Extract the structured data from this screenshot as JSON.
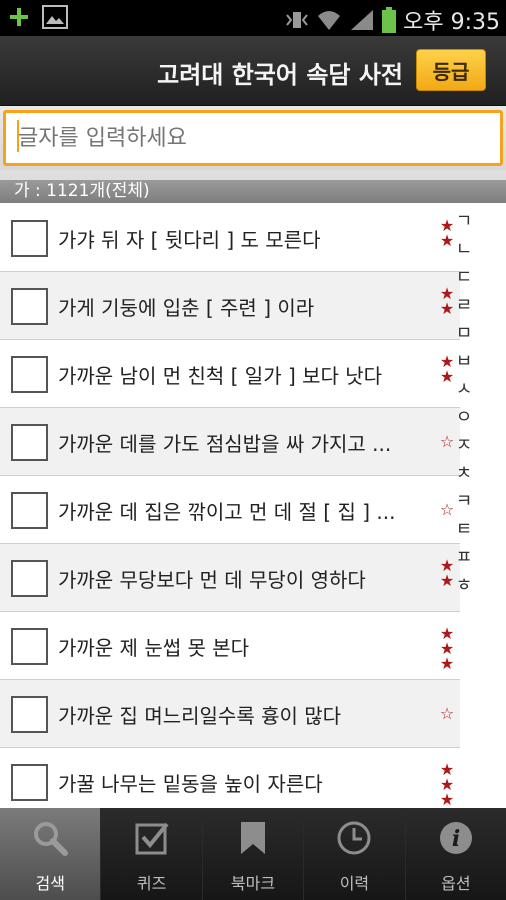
{
  "status_bar": {
    "time": "오후 9:35",
    "left_icons": [
      "add-icon",
      "image-icon"
    ],
    "right_icons": [
      "vibrate-icon",
      "wifi-icon",
      "signal-icon",
      "battery-icon"
    ]
  },
  "titlebar": {
    "title": "고려대 한국어 속담 사전",
    "grade_label": "등급"
  },
  "search": {
    "placeholder": "글자를 입력하세요",
    "value": ""
  },
  "section_header": "가 : 1121개(전체)",
  "list": {
    "items": [
      {
        "text": "가갸 뒤 자 [ 뒷다리 ] 도 모른다",
        "stars": 2
      },
      {
        "text": "가게 기둥에 입춘 [ 주련 ] 이라",
        "stars": 2
      },
      {
        "text": "가까운 남이 먼 친척 [ 일가 ] 보다 낫다",
        "stars": 2
      },
      {
        "text": "가까운 데를 가도 점심밥을 싸 가지고 ...",
        "stars": 0
      },
      {
        "text": "가까운 데 집은 깎이고 먼 데 절 [ 집 ] ...",
        "stars": 0
      },
      {
        "text": "가까운 무당보다 먼 데 무당이 영하다",
        "stars": 2
      },
      {
        "text": "가까운 제 눈썹 못 본다",
        "stars": 3
      },
      {
        "text": "가까운 집 며느리일수록 흉이 많다",
        "stars": 0
      },
      {
        "text": "가꿀 나무는 밑동을 높이 자른다",
        "stars": 3
      }
    ],
    "star_filled": "★",
    "star_empty": "☆"
  },
  "index_bar": [
    "ㄱ",
    "ㄴ",
    "ㄷ",
    "ㄹ",
    "ㅁ",
    "ㅂ",
    "ㅅ",
    "ㅇ",
    "ㅈ",
    "ㅊ",
    "ㅋ",
    "ㅌ",
    "ㅍ",
    "ㅎ"
  ],
  "nav": {
    "tabs": [
      {
        "label": "검색",
        "icon": "search-icon",
        "active": true
      },
      {
        "label": "퀴즈",
        "icon": "checkbox-icon",
        "active": false
      },
      {
        "label": "북마크",
        "icon": "bookmark-icon",
        "active": false
      },
      {
        "label": "이력",
        "icon": "clock-icon",
        "active": false
      },
      {
        "label": "옵션",
        "icon": "info-icon",
        "active": false
      }
    ]
  },
  "colors": {
    "accent": "#f7a21b",
    "star": "#b01818",
    "titlebar": "#2a2a2a",
    "nav_active": "#666666"
  }
}
